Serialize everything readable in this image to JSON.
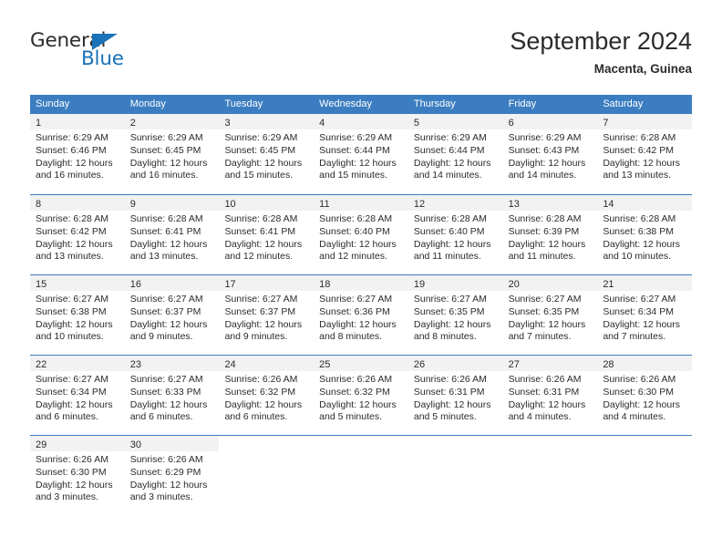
{
  "brand": {
    "name_part1": "General",
    "name_part2": "Blue",
    "triangle_icon": "triangle-icon",
    "color_dark": "#2b2b2b",
    "color_blue": "#1a72b8"
  },
  "header": {
    "title": "September 2024",
    "subtitle": "Macenta, Guinea"
  },
  "theme": {
    "header_bg": "#3b7dc0",
    "day_band_bg": "#f2f2f2",
    "text": "#2b2b2b",
    "cell_bg": "#ffffff"
  },
  "weekdays": [
    "Sunday",
    "Monday",
    "Tuesday",
    "Wednesday",
    "Thursday",
    "Friday",
    "Saturday"
  ],
  "weeks": [
    [
      {
        "day": "1",
        "sunrise": "Sunrise: 6:29 AM",
        "sunset": "Sunset: 6:46 PM",
        "daylight1": "Daylight: 12 hours",
        "daylight2": "and 16 minutes."
      },
      {
        "day": "2",
        "sunrise": "Sunrise: 6:29 AM",
        "sunset": "Sunset: 6:45 PM",
        "daylight1": "Daylight: 12 hours",
        "daylight2": "and 16 minutes."
      },
      {
        "day": "3",
        "sunrise": "Sunrise: 6:29 AM",
        "sunset": "Sunset: 6:45 PM",
        "daylight1": "Daylight: 12 hours",
        "daylight2": "and 15 minutes."
      },
      {
        "day": "4",
        "sunrise": "Sunrise: 6:29 AM",
        "sunset": "Sunset: 6:44 PM",
        "daylight1": "Daylight: 12 hours",
        "daylight2": "and 15 minutes."
      },
      {
        "day": "5",
        "sunrise": "Sunrise: 6:29 AM",
        "sunset": "Sunset: 6:44 PM",
        "daylight1": "Daylight: 12 hours",
        "daylight2": "and 14 minutes."
      },
      {
        "day": "6",
        "sunrise": "Sunrise: 6:29 AM",
        "sunset": "Sunset: 6:43 PM",
        "daylight1": "Daylight: 12 hours",
        "daylight2": "and 14 minutes."
      },
      {
        "day": "7",
        "sunrise": "Sunrise: 6:28 AM",
        "sunset": "Sunset: 6:42 PM",
        "daylight1": "Daylight: 12 hours",
        "daylight2": "and 13 minutes."
      }
    ],
    [
      {
        "day": "8",
        "sunrise": "Sunrise: 6:28 AM",
        "sunset": "Sunset: 6:42 PM",
        "daylight1": "Daylight: 12 hours",
        "daylight2": "and 13 minutes."
      },
      {
        "day": "9",
        "sunrise": "Sunrise: 6:28 AM",
        "sunset": "Sunset: 6:41 PM",
        "daylight1": "Daylight: 12 hours",
        "daylight2": "and 13 minutes."
      },
      {
        "day": "10",
        "sunrise": "Sunrise: 6:28 AM",
        "sunset": "Sunset: 6:41 PM",
        "daylight1": "Daylight: 12 hours",
        "daylight2": "and 12 minutes."
      },
      {
        "day": "11",
        "sunrise": "Sunrise: 6:28 AM",
        "sunset": "Sunset: 6:40 PM",
        "daylight1": "Daylight: 12 hours",
        "daylight2": "and 12 minutes."
      },
      {
        "day": "12",
        "sunrise": "Sunrise: 6:28 AM",
        "sunset": "Sunset: 6:40 PM",
        "daylight1": "Daylight: 12 hours",
        "daylight2": "and 11 minutes."
      },
      {
        "day": "13",
        "sunrise": "Sunrise: 6:28 AM",
        "sunset": "Sunset: 6:39 PM",
        "daylight1": "Daylight: 12 hours",
        "daylight2": "and 11 minutes."
      },
      {
        "day": "14",
        "sunrise": "Sunrise: 6:28 AM",
        "sunset": "Sunset: 6:38 PM",
        "daylight1": "Daylight: 12 hours",
        "daylight2": "and 10 minutes."
      }
    ],
    [
      {
        "day": "15",
        "sunrise": "Sunrise: 6:27 AM",
        "sunset": "Sunset: 6:38 PM",
        "daylight1": "Daylight: 12 hours",
        "daylight2": "and 10 minutes."
      },
      {
        "day": "16",
        "sunrise": "Sunrise: 6:27 AM",
        "sunset": "Sunset: 6:37 PM",
        "daylight1": "Daylight: 12 hours",
        "daylight2": "and 9 minutes."
      },
      {
        "day": "17",
        "sunrise": "Sunrise: 6:27 AM",
        "sunset": "Sunset: 6:37 PM",
        "daylight1": "Daylight: 12 hours",
        "daylight2": "and 9 minutes."
      },
      {
        "day": "18",
        "sunrise": "Sunrise: 6:27 AM",
        "sunset": "Sunset: 6:36 PM",
        "daylight1": "Daylight: 12 hours",
        "daylight2": "and 8 minutes."
      },
      {
        "day": "19",
        "sunrise": "Sunrise: 6:27 AM",
        "sunset": "Sunset: 6:35 PM",
        "daylight1": "Daylight: 12 hours",
        "daylight2": "and 8 minutes."
      },
      {
        "day": "20",
        "sunrise": "Sunrise: 6:27 AM",
        "sunset": "Sunset: 6:35 PM",
        "daylight1": "Daylight: 12 hours",
        "daylight2": "and 7 minutes."
      },
      {
        "day": "21",
        "sunrise": "Sunrise: 6:27 AM",
        "sunset": "Sunset: 6:34 PM",
        "daylight1": "Daylight: 12 hours",
        "daylight2": "and 7 minutes."
      }
    ],
    [
      {
        "day": "22",
        "sunrise": "Sunrise: 6:27 AM",
        "sunset": "Sunset: 6:34 PM",
        "daylight1": "Daylight: 12 hours",
        "daylight2": "and 6 minutes."
      },
      {
        "day": "23",
        "sunrise": "Sunrise: 6:27 AM",
        "sunset": "Sunset: 6:33 PM",
        "daylight1": "Daylight: 12 hours",
        "daylight2": "and 6 minutes."
      },
      {
        "day": "24",
        "sunrise": "Sunrise: 6:26 AM",
        "sunset": "Sunset: 6:32 PM",
        "daylight1": "Daylight: 12 hours",
        "daylight2": "and 6 minutes."
      },
      {
        "day": "25",
        "sunrise": "Sunrise: 6:26 AM",
        "sunset": "Sunset: 6:32 PM",
        "daylight1": "Daylight: 12 hours",
        "daylight2": "and 5 minutes."
      },
      {
        "day": "26",
        "sunrise": "Sunrise: 6:26 AM",
        "sunset": "Sunset: 6:31 PM",
        "daylight1": "Daylight: 12 hours",
        "daylight2": "and 5 minutes."
      },
      {
        "day": "27",
        "sunrise": "Sunrise: 6:26 AM",
        "sunset": "Sunset: 6:31 PM",
        "daylight1": "Daylight: 12 hours",
        "daylight2": "and 4 minutes."
      },
      {
        "day": "28",
        "sunrise": "Sunrise: 6:26 AM",
        "sunset": "Sunset: 6:30 PM",
        "daylight1": "Daylight: 12 hours",
        "daylight2": "and 4 minutes."
      }
    ],
    [
      {
        "day": "29",
        "sunrise": "Sunrise: 6:26 AM",
        "sunset": "Sunset: 6:30 PM",
        "daylight1": "Daylight: 12 hours",
        "daylight2": "and 3 minutes."
      },
      {
        "day": "30",
        "sunrise": "Sunrise: 6:26 AM",
        "sunset": "Sunset: 6:29 PM",
        "daylight1": "Daylight: 12 hours",
        "daylight2": "and 3 minutes."
      },
      {
        "day": "",
        "sunrise": "",
        "sunset": "",
        "daylight1": "",
        "daylight2": ""
      },
      {
        "day": "",
        "sunrise": "",
        "sunset": "",
        "daylight1": "",
        "daylight2": ""
      },
      {
        "day": "",
        "sunrise": "",
        "sunset": "",
        "daylight1": "",
        "daylight2": ""
      },
      {
        "day": "",
        "sunrise": "",
        "sunset": "",
        "daylight1": "",
        "daylight2": ""
      },
      {
        "day": "",
        "sunrise": "",
        "sunset": "",
        "daylight1": "",
        "daylight2": ""
      }
    ]
  ]
}
